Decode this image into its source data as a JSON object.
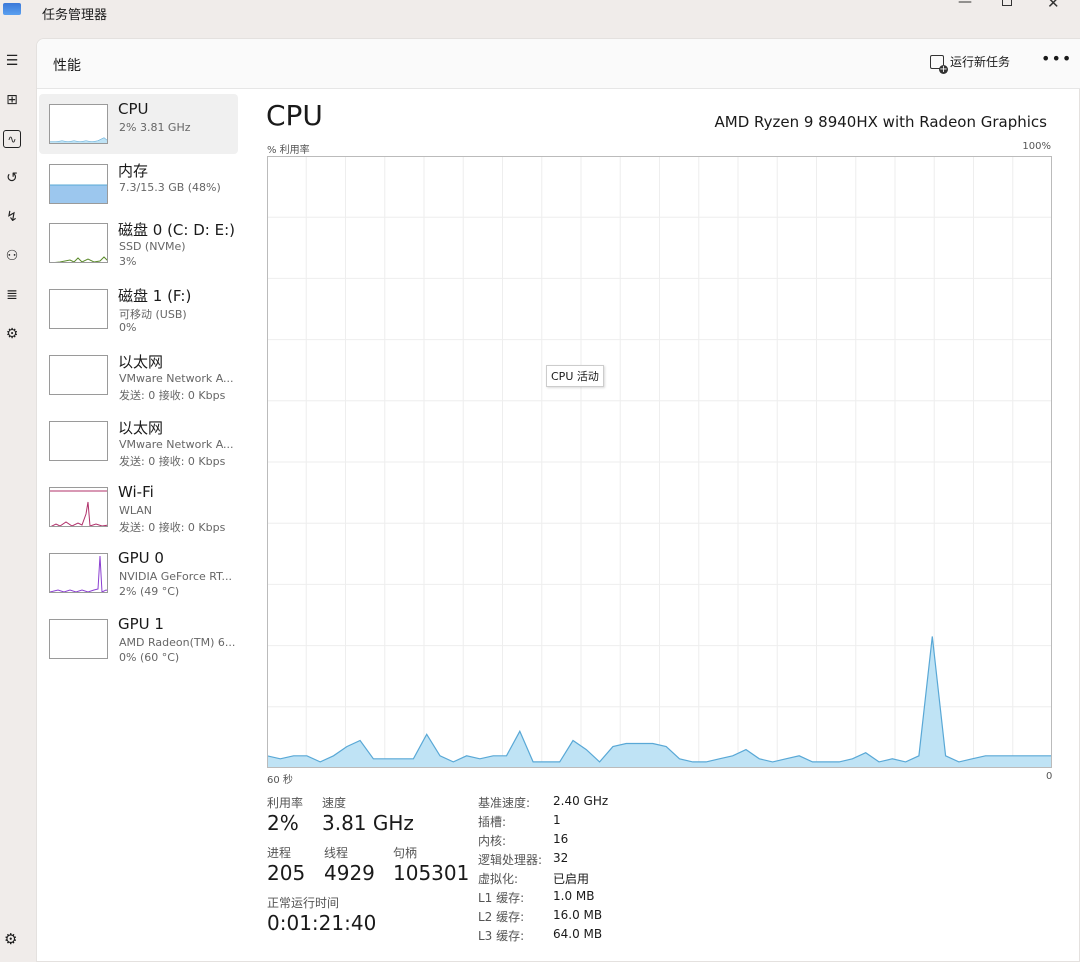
{
  "app": {
    "title": "任务管理器"
  },
  "header": {
    "title": "性能",
    "run_task": "运行新任务",
    "more": "•••"
  },
  "sidebar_list": [
    {
      "name": "CPU",
      "sub1": "2% 3.81 GHz",
      "sub2": ""
    },
    {
      "name": "内存",
      "sub1": "7.3/15.3 GB (48%)",
      "sub2": ""
    },
    {
      "name": "磁盘 0 (C: D: E:)",
      "sub1": "SSD (NVMe)",
      "sub2": "3%"
    },
    {
      "name": "磁盘 1 (F:)",
      "sub1": "可移动 (USB)",
      "sub2": "0%"
    },
    {
      "name": "以太网",
      "sub1": "VMware Network A...",
      "sub2": "发送: 0 接收: 0 Kbps"
    },
    {
      "name": "以太网",
      "sub1": "VMware Network A...",
      "sub2": "发送: 0 接收: 0 Kbps"
    },
    {
      "name": "Wi-Fi",
      "sub1": "WLAN",
      "sub2": "发送: 0 接收: 0 Kbps"
    },
    {
      "name": "GPU 0",
      "sub1": "NVIDIA GeForce RT...",
      "sub2": "2% (49 °C)"
    },
    {
      "name": "GPU 1",
      "sub1": "AMD Radeon(TM) 6...",
      "sub2": "0% (60 °C)"
    }
  ],
  "cpu": {
    "title": "CPU",
    "model": "AMD Ryzen 9 8940HX with Radeon Graphics",
    "chart_left_label": "% 利用率",
    "chart_right_label": "100%",
    "tooltip": "CPU 活动",
    "axis_left": "60 秒",
    "axis_right": "0"
  },
  "stats": {
    "utilization_label": "利用率",
    "utilization": "2%",
    "speed_label": "速度",
    "speed": "3.81 GHz",
    "processes_label": "进程",
    "processes": "205",
    "threads_label": "线程",
    "threads": "4929",
    "handles_label": "句柄",
    "handles": "105301",
    "uptime_label": "正常运行时间",
    "uptime": "0:01:21:40"
  },
  "specs": [
    {
      "label": "基准速度:",
      "value": "2.40 GHz"
    },
    {
      "label": "插槽:",
      "value": "1"
    },
    {
      "label": "内核:",
      "value": "16"
    },
    {
      "label": "逻辑处理器:",
      "value": "32"
    },
    {
      "label": "虚拟化:",
      "value": "已启用"
    },
    {
      "label": "L1 缓存:",
      "value": "1.0 MB"
    },
    {
      "label": "L2 缓存:",
      "value": "16.0 MB"
    },
    {
      "label": "L3 缓存:",
      "value": "64.0 MB"
    }
  ],
  "chart_data": {
    "type": "area",
    "ylim": [
      0,
      100
    ],
    "x": [
      0,
      1,
      2,
      3,
      4,
      5,
      6,
      7,
      8,
      9,
      10,
      11,
      12,
      13,
      14,
      15,
      16,
      17,
      18,
      19,
      20,
      21,
      22,
      23,
      24,
      25,
      26,
      27,
      28,
      29,
      30,
      31,
      32,
      33,
      34,
      35,
      36,
      37,
      38,
      39,
      40,
      41,
      42,
      43,
      44,
      45,
      46,
      47,
      48,
      49,
      50,
      51,
      52,
      53,
      54,
      55,
      56,
      57,
      58,
      59
    ],
    "values": [
      2,
      1.5,
      2,
      2,
      1,
      2,
      3.5,
      4.5,
      1.5,
      1.5,
      1.5,
      1.5,
      5.5,
      2,
      1,
      2,
      1.5,
      2,
      2,
      6,
      1,
      1,
      1,
      4.5,
      3,
      1,
      3.5,
      4,
      4,
      4,
      3.5,
      1.5,
      1,
      1,
      1.5,
      2,
      3,
      1.5,
      1,
      1.5,
      2,
      1,
      1,
      1,
      1.5,
      2.5,
      1,
      1.5,
      1,
      2,
      21.5,
      2,
      1,
      1.5,
      2,
      2,
      2,
      2,
      2,
      2
    ],
    "colors": {
      "line": "#59a8d6",
      "fill": "#bfe3f5"
    }
  },
  "colors": {
    "accent": "#59a8d6",
    "memory": "#9cc7ee",
    "disk": "#5a8a2a",
    "wifi": "#b0306a",
    "gpu": "#8b3fd1"
  }
}
